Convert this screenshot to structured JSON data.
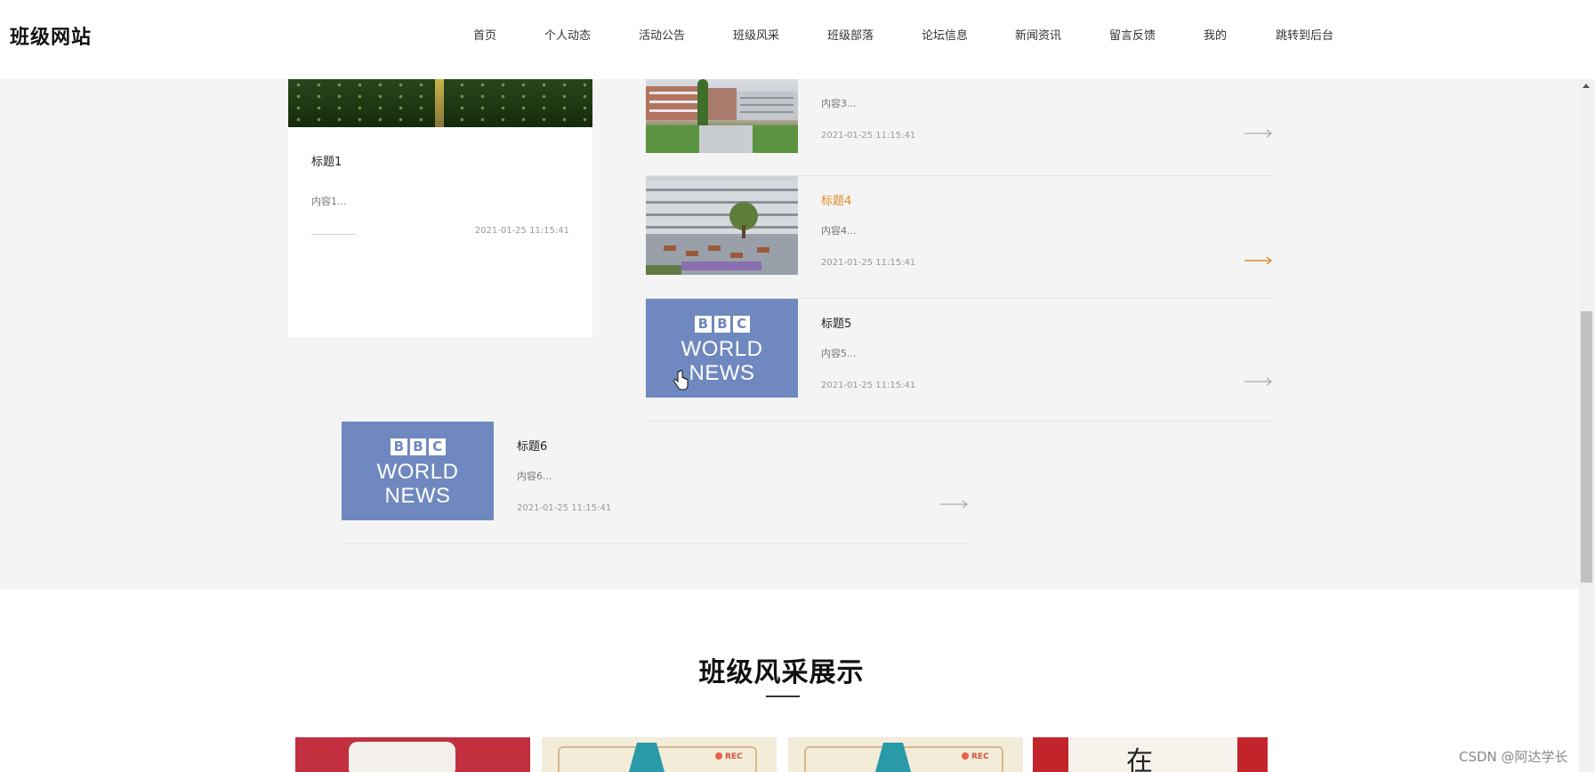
{
  "header": {
    "brand": "班级网站",
    "nav": [
      "首页",
      "个人动态",
      "活动公告",
      "班级风采",
      "班级部落",
      "论坛信息",
      "新闻资讯",
      "留言反馈",
      "我的",
      "跳转到后台"
    ]
  },
  "featured": {
    "title": "标题1",
    "desc": "内容1...",
    "date": "2021-01-25 11:15:41"
  },
  "list": [
    {
      "desc": "内容3...",
      "date": "2021-01-25 11:15:41"
    },
    {
      "title": "标题4",
      "desc": "内容4...",
      "date": "2021-01-25 11:15:41"
    },
    {
      "title": "标题5",
      "desc": "内容5...",
      "date": "2021-01-25 11:15:41"
    },
    {
      "title": "标题6",
      "desc": "内容6...",
      "date": "2021-01-25 11:15:41"
    }
  ],
  "bbc": {
    "boxes": [
      "B",
      "B",
      "C"
    ],
    "line1": "WORLD",
    "line2": "NEWS"
  },
  "gallery_section": {
    "title": "班级风采展示",
    "rec_label": "REC",
    "char": "在"
  },
  "watermark": "CSDN @阿达学长",
  "colors": {
    "accent": "#e08a2a",
    "bbc_blue": "#6f88bf",
    "grey_bg": "#f4f4f4"
  }
}
